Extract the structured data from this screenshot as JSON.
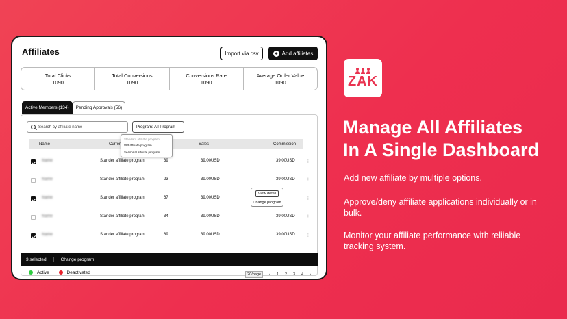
{
  "app": {
    "title": "Affiliates",
    "import_label": "Import via csv",
    "add_label": "Add affiliates"
  },
  "stats": [
    {
      "label": "Total Clicks",
      "value": "1090"
    },
    {
      "label": "Total Conversions",
      "value": "1090"
    },
    {
      "label": "Conversions Rate",
      "value": "1090"
    },
    {
      "label": "Average Order Value",
      "value": "1090"
    }
  ],
  "tabs": [
    {
      "label": "Active Members (134)"
    },
    {
      "label": "Pending Approvals (56)"
    }
  ],
  "search": {
    "placeholder": "Search by affiliate name"
  },
  "program_filter": {
    "label": "Program: All Program",
    "options": [
      "Standard affiliate program",
      "VIP affiliate program",
      "Seasonal affiliate program"
    ]
  },
  "table": {
    "headers": {
      "name": "Name",
      "program": "Current Program",
      "sales": "Sales",
      "commission": "Commission"
    },
    "rows": [
      {
        "checked": true,
        "name": "Name",
        "program": "Stander affiliate program",
        "qty": "39",
        "sales": "39.00USD",
        "commission": "39.00USD",
        "more": "⋮"
      },
      {
        "checked": false,
        "name": "Name",
        "program": "Stander affiliate program",
        "qty": "23",
        "sales": "39.00USD",
        "commission": "39.00USD",
        "more": "⋮"
      },
      {
        "checked": true,
        "name": "Name",
        "program": "Stander affiliate program",
        "qty": "67",
        "sales": "39.00USD",
        "commission": "39.00USD",
        "more": "⋮"
      },
      {
        "checked": false,
        "name": "Name",
        "program": "Stander affiliate program",
        "qty": "34",
        "sales": "39.00USD",
        "commission": "39.00USD",
        "more": "⋮"
      },
      {
        "checked": true,
        "name": "Name",
        "program": "Stander affiliate program",
        "qty": "89",
        "sales": "39.00USD",
        "commission": "39.00USD",
        "more": "⋮"
      }
    ]
  },
  "context_menu": {
    "view": "View detail",
    "change": "Change program"
  },
  "bulk_bar": {
    "selected": "3 selected",
    "action": "Change program"
  },
  "legend": {
    "active": "Active",
    "deactivated": "Deactivated",
    "active_color": "#2ecc40",
    "deactivated_color": "#e8202a"
  },
  "pager": {
    "per_page": "20/page",
    "pages": [
      "1",
      "2",
      "3",
      "4"
    ],
    "prev": "‹",
    "next": "›"
  },
  "logo": {
    "word": "ZAK",
    "color": "#e93350"
  },
  "marketing": {
    "headline_line1": "Manage All Affiliates",
    "headline_line2": "In A Single Dashboard",
    "bullets": [
      "Add new affiliate by multiple options.",
      "Approve/deny affiliate applications individually or in bulk.",
      "Monitor your affiliate performance with reliiable tracking system."
    ]
  }
}
